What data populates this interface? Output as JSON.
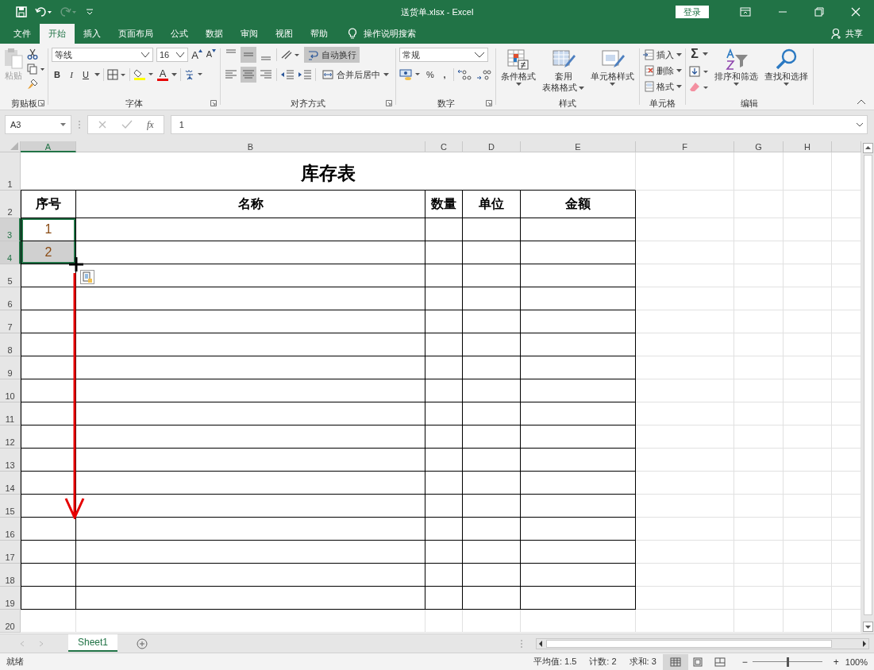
{
  "window": {
    "title": "送货单.xlsx  -  Excel",
    "sign_in": "登录",
    "redo_enabled": false
  },
  "tabs": [
    {
      "label": "文件",
      "selected": false
    },
    {
      "label": "开始",
      "selected": true
    },
    {
      "label": "插入",
      "selected": false
    },
    {
      "label": "页面布局",
      "selected": false
    },
    {
      "label": "公式",
      "selected": false
    },
    {
      "label": "数据",
      "selected": false
    },
    {
      "label": "审阅",
      "selected": false
    },
    {
      "label": "视图",
      "selected": false
    },
    {
      "label": "帮助",
      "selected": false
    }
  ],
  "tell_me": "操作说明搜索",
  "share": "共享",
  "ribbon": {
    "clipboard": {
      "label": "剪贴板",
      "paste": "粘贴",
      "paste_disabled": true
    },
    "font": {
      "label": "字体",
      "font_name": "等线",
      "font_size": "16",
      "grow": "A",
      "shrink": "A",
      "bold": "B",
      "italic": "I",
      "underline": "U",
      "font_color": "A"
    },
    "alignment": {
      "label": "对齐方式",
      "vertical_align": [
        {
          "kind": "top",
          "selected": false
        },
        {
          "kind": "middle",
          "selected": true
        },
        {
          "kind": "bottom",
          "selected": false
        }
      ],
      "horizontal_align": [
        {
          "kind": "left",
          "selected": false
        },
        {
          "kind": "center",
          "selected": true
        },
        {
          "kind": "right",
          "selected": false
        }
      ],
      "wrap_text": "自动换行",
      "wrap_selected": true,
      "merge": "合并后居中"
    },
    "number": {
      "label": "数字",
      "format": "常规",
      "percent": "%",
      "comma": ","
    },
    "styles": {
      "label": "样式",
      "buttons": [
        {
          "kind": "conditional",
          "lines": [
            "条件格式"
          ]
        },
        {
          "kind": "table",
          "lines": [
            "套用",
            "表格格式"
          ]
        },
        {
          "kind": "cell",
          "lines": [
            "单元格样式"
          ]
        }
      ]
    },
    "cells": {
      "label": "单元格",
      "buttons": [
        {
          "kind": "insert",
          "label": "插入"
        },
        {
          "kind": "delete",
          "label": "删除"
        },
        {
          "kind": "format",
          "label": "格式"
        }
      ]
    },
    "editing": {
      "label": "编辑",
      "sum": "Σ",
      "sort": "排序和筛选",
      "find": "查找和选择"
    }
  },
  "formula_bar": {
    "name_box": "A3",
    "function_label": "fx",
    "value": "1"
  },
  "sheet": {
    "columns": [
      {
        "label": "A",
        "selected": true
      },
      {
        "label": "B",
        "selected": false
      },
      {
        "label": "C",
        "selected": false
      },
      {
        "label": "D",
        "selected": false
      },
      {
        "label": "E",
        "selected": false
      },
      {
        "label": "F",
        "selected": false
      },
      {
        "label": "G",
        "selected": false
      },
      {
        "label": "H",
        "selected": false
      }
    ],
    "rows": [
      {
        "label": "1",
        "selected": false
      },
      {
        "label": "2",
        "selected": false
      },
      {
        "label": "3",
        "selected": true
      },
      {
        "label": "4",
        "selected": true
      },
      {
        "label": "5",
        "selected": false
      },
      {
        "label": "6",
        "selected": false
      },
      {
        "label": "7",
        "selected": false
      },
      {
        "label": "8",
        "selected": false
      },
      {
        "label": "9",
        "selected": false
      },
      {
        "label": "10",
        "selected": false
      },
      {
        "label": "11",
        "selected": false
      },
      {
        "label": "12",
        "selected": false
      },
      {
        "label": "13",
        "selected": false
      },
      {
        "label": "14",
        "selected": false
      },
      {
        "label": "15",
        "selected": false
      },
      {
        "label": "16",
        "selected": false
      },
      {
        "label": "17",
        "selected": false
      },
      {
        "label": "18",
        "selected": false
      },
      {
        "label": "19",
        "selected": false
      },
      {
        "label": "20",
        "selected": false
      }
    ],
    "title": "库存表",
    "headers": [
      "序号",
      "名称",
      "数量",
      "单位",
      "金额"
    ],
    "serials": [
      {
        "text": "1",
        "selected": true,
        "active": true
      },
      {
        "text": "2",
        "selected": true,
        "active": false
      }
    ]
  },
  "sheet_tabs": [
    {
      "label": "Sheet1",
      "selected": true
    }
  ],
  "status_bar": {
    "state": "就绪",
    "average": "平均值: 1.5",
    "count": "计数: 2",
    "sum": "求和: 3",
    "views": [
      {
        "kind": "normal",
        "selected": true
      },
      {
        "kind": "layout",
        "selected": false
      },
      {
        "kind": "break",
        "selected": false
      }
    ],
    "zoom_out": "−",
    "zoom_in": "+",
    "zoom": "100%",
    "zoom_level": {
      "level": 0.5
    }
  }
}
